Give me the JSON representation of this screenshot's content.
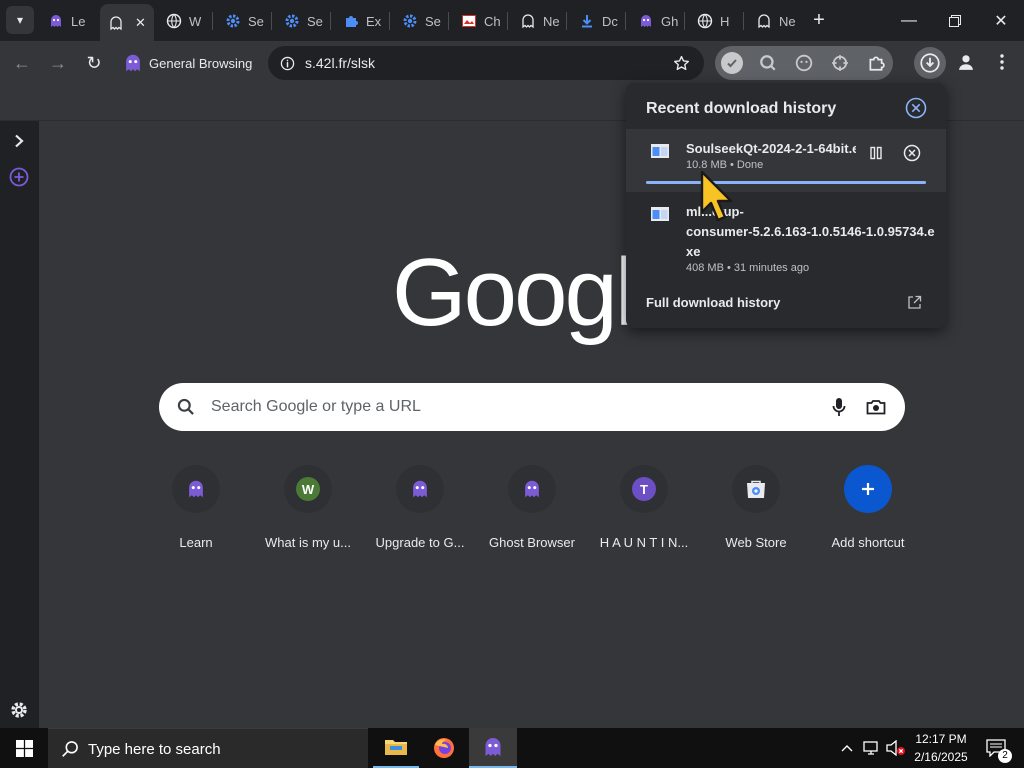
{
  "tabs": [
    {
      "label": "Le",
      "icon": "ghost-icon"
    },
    {
      "label": "",
      "icon": "ghost-icon",
      "active": true
    },
    {
      "label": "W",
      "icon": "globe-icon"
    },
    {
      "label": "Se",
      "icon": "gear-icon"
    },
    {
      "label": "Se",
      "icon": "gear-icon"
    },
    {
      "label": "Ex",
      "icon": "puzzle-icon"
    },
    {
      "label": "Se",
      "icon": "gear-icon"
    },
    {
      "label": "Ch",
      "icon": "image-icon"
    },
    {
      "label": "Ne",
      "icon": "ghost-icon"
    },
    {
      "label": "Dc",
      "icon": "download-icon"
    },
    {
      "label": "Gh",
      "icon": "ghost-icon"
    },
    {
      "label": "H",
      "icon": "globe-icon"
    },
    {
      "label": "Ne",
      "icon": "ghost-icon"
    }
  ],
  "toolbar": {
    "profile_label": "General Browsing",
    "url": "s.42l.fr/slsk"
  },
  "google": {
    "logo": "Googl",
    "search_placeholder": "Search Google or type a URL"
  },
  "shortcuts": [
    {
      "label": "Learn",
      "icon": "ghost-icon"
    },
    {
      "label": "What is my u...",
      "letter": "W",
      "color": "#4a7a36"
    },
    {
      "label": "Upgrade to G...",
      "icon": "ghost-icon"
    },
    {
      "label": "Ghost Browser",
      "icon": "ghost-icon"
    },
    {
      "label": "H A U N T I N...",
      "letter": "T",
      "color": "#6c4fc4"
    },
    {
      "label": "Web Store",
      "icon": "webstore-icon"
    },
    {
      "label": "Add shortcut",
      "icon": "plus-icon",
      "color": "#0b57d0"
    }
  ],
  "downloads": {
    "title": "Recent download history",
    "items": [
      {
        "name": "SoulseekQt-2024-2-1-64bit.e",
        "meta": "10.8 MB • Done",
        "progress": 1.0
      },
      {
        "name_lines": [
          "ml...etup-",
          "consumer-5.2.6.163-1.0.5146-1.0.95734.e",
          "xe"
        ],
        "meta": "408 MB • 31 minutes ago"
      }
    ],
    "footer": "Full download history"
  },
  "taskbar": {
    "search_placeholder": "Type here to search",
    "time": "12:17 PM",
    "date": "2/16/2025",
    "notification_count": "2"
  },
  "colors": {
    "accent_blue": "#8ab4f8",
    "ghost_purple": "#7b5cd6",
    "cursor_yellow": "#f7c325"
  }
}
